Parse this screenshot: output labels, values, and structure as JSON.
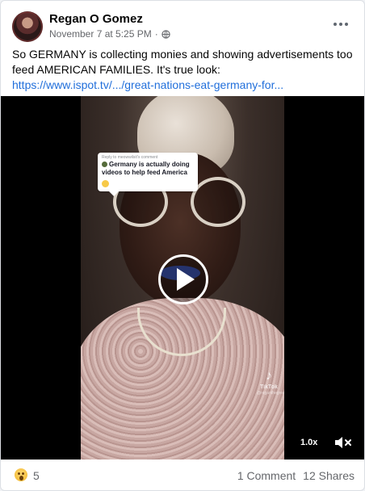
{
  "post": {
    "author": "Regan O Gomez",
    "date": "November 7 at 5:25 PM",
    "separator": "·",
    "privacy_icon": "globe-icon",
    "more_icon": "more-options-icon",
    "text": "So GERMANY is collecting monies and showing advertisements too feed AMERICAN FAMILIES. It's true look: ",
    "link": "https://www.ispot.tv/.../great-nations-eat-germany-for..."
  },
  "video": {
    "overlay_reply_to": "Reply to meowwilsit's comment",
    "overlay_comment": "Germany is actually doing videos to help feed America",
    "watermark": "TikTok",
    "watermark_handle": "@reganthegreat",
    "play_icon": "play-icon",
    "speed": "1.0x",
    "mute_icon": "volume-muted-icon"
  },
  "footer": {
    "reaction_icon": "wow-reaction-icon",
    "reaction_count": "5",
    "comments": "1 Comment",
    "shares": "12 Shares"
  },
  "colors": {
    "link": "#216fdb",
    "secondary_text": "#65676b",
    "video_background": "#000000"
  }
}
